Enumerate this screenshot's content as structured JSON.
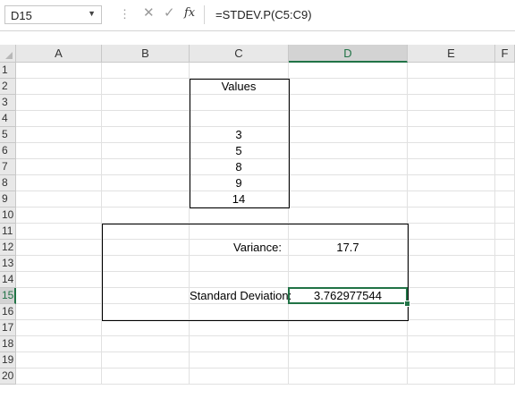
{
  "formula_bar": {
    "name_box": "D15",
    "name_box_arrow": "▼",
    "separator": "⋮",
    "cancel_icon": "✕",
    "enter_icon": "✓",
    "fx_label": "fx",
    "formula": "=STDEV.P(C5:C9)"
  },
  "columns": [
    "A",
    "B",
    "C",
    "D",
    "E",
    "F"
  ],
  "rows": [
    "1",
    "2",
    "3",
    "4",
    "5",
    "6",
    "7",
    "8",
    "9",
    "10",
    "11",
    "12",
    "13",
    "14",
    "15",
    "16",
    "17",
    "18",
    "19",
    "20"
  ],
  "selected": {
    "column": "D",
    "row": "15"
  },
  "cells": {
    "C2": "Values",
    "C5": "3",
    "C6": "5",
    "C7": "8",
    "C8": "9",
    "C9": "14",
    "C12": "Variance:",
    "D12": "17.7",
    "C15": "Standard Deviation:",
    "D15": "3.762977544"
  },
  "colors": {
    "accent": "#217346",
    "header_bg": "#e8e8e8",
    "gridline": "#e1e1e1"
  }
}
